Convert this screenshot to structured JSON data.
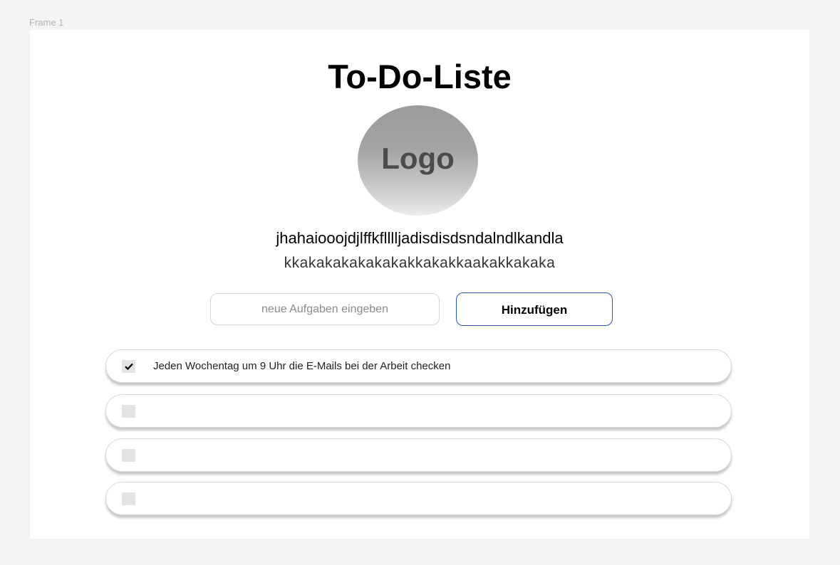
{
  "frame": {
    "label": "Frame 1"
  },
  "header": {
    "title": "To-Do-Liste"
  },
  "logo": {
    "label": "Logo"
  },
  "description": {
    "line1": "jhahaiooojdjlffkflllljadisdisdsndalndlkandla",
    "line2": "kkakakakakakakakkakakkaakakkakaka"
  },
  "task_form": {
    "input_placeholder": "neue Aufgaben eingeben",
    "input_value": "",
    "add_button_label": "Hinzufügen"
  },
  "todos": [
    {
      "text": "Jeden Wochentag um 9 Uhr die E-Mails bei der Arbeit checken",
      "checked": true,
      "checkbox_icon": "checkmark-icon"
    },
    {
      "text": "",
      "checked": false,
      "checkbox_icon": ""
    },
    {
      "text": "",
      "checked": false,
      "checkbox_icon": ""
    },
    {
      "text": "",
      "checked": false,
      "checkbox_icon": ""
    }
  ],
  "colors": {
    "page_background": "#f4f4f4",
    "frame_background": "#ffffff",
    "button_border": "#2f55a8",
    "checkbox_fill": "#e4e4e4",
    "logo_text": "#4e4a49"
  }
}
